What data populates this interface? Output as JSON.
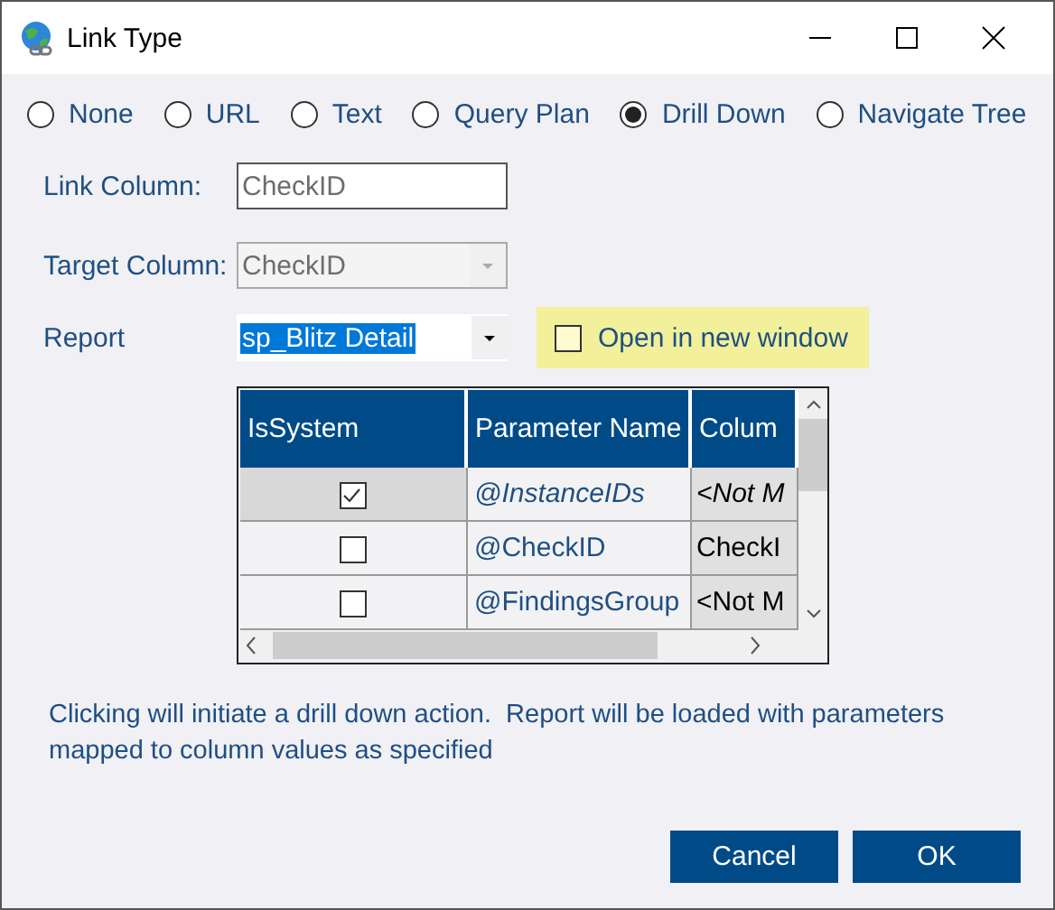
{
  "window": {
    "title": "Link Type"
  },
  "link_types": [
    {
      "label": "None",
      "selected": false
    },
    {
      "label": "URL",
      "selected": false
    },
    {
      "label": "Text",
      "selected": false
    },
    {
      "label": "Query Plan",
      "selected": false
    },
    {
      "label": "Drill Down",
      "selected": true
    },
    {
      "label": "Navigate Tree",
      "selected": false
    }
  ],
  "link_column": {
    "label": "Link Column:",
    "value": "CheckID"
  },
  "target_column": {
    "label": "Target Column:",
    "value": "CheckID",
    "disabled": true
  },
  "report": {
    "label": "Report",
    "value": "sp_Blitz Detail"
  },
  "open_in_new_window": {
    "label": "Open in new window",
    "checked": false
  },
  "parameters": {
    "columns": [
      "IsSystem",
      "Parameter Name",
      "Colum"
    ],
    "rows": [
      {
        "is_system": true,
        "selected": true,
        "name": "@InstanceIDs",
        "column": "<Not M"
      },
      {
        "is_system": false,
        "selected": false,
        "name": "@CheckID",
        "column": "CheckI"
      },
      {
        "is_system": false,
        "selected": false,
        "name": "@FindingsGroup",
        "column": "<Not M"
      }
    ]
  },
  "description": "Clicking will initiate a drill down action.  Report will be loaded with parameters mapped to column values as specified",
  "buttons": [
    {
      "label": "Cancel"
    },
    {
      "label": "OK"
    }
  ]
}
